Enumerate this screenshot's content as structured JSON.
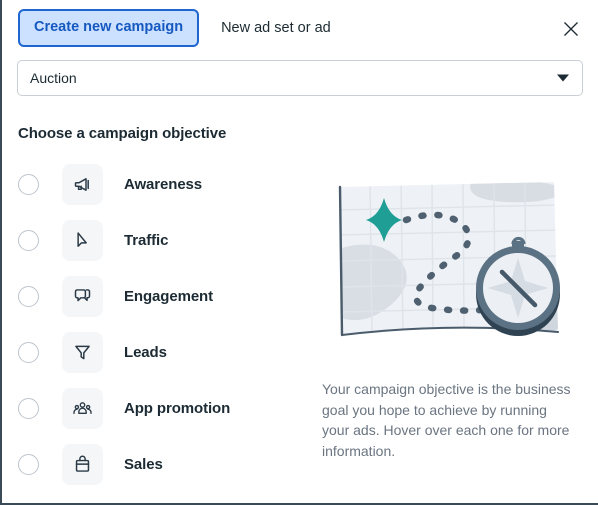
{
  "header": {
    "primary_tab": "Create new campaign",
    "secondary_tab": "New ad set or ad",
    "close_icon": "close-icon"
  },
  "buying_type": {
    "value": "Auction",
    "placeholder": "Auction",
    "caret_icon": "chevron-down-icon"
  },
  "objective_section": {
    "title": "Choose a campaign objective",
    "items": [
      {
        "label": "Awareness",
        "icon": "megaphone-icon",
        "selected": false
      },
      {
        "label": "Traffic",
        "icon": "cursor-icon",
        "selected": false
      },
      {
        "label": "Engagement",
        "icon": "chat-bubbles-icon",
        "selected": false
      },
      {
        "label": "Leads",
        "icon": "funnel-icon",
        "selected": false
      },
      {
        "label": "App promotion",
        "icon": "people-icon",
        "selected": false
      },
      {
        "label": "Sales",
        "icon": "shopping-bag-icon",
        "selected": false
      }
    ]
  },
  "info_panel": {
    "illustration": "map-with-compass-illustration",
    "description": "Your campaign objective is the business goal you hope to achieve by running your ads. Hover over each one for more information."
  },
  "colors": {
    "accent_blue": "#1559c0",
    "tab_bg": "#cce0ff",
    "tab_border": "#1e66d0",
    "text_dark": "#1c2b33",
    "text_muted": "#6a7581",
    "tile_bg": "#f5f6f7",
    "radio_border": "#bcc4cd",
    "map_teal": "#1f9e96",
    "map_paper": "#eef1f5",
    "compass_dark": "#3c4d5c"
  }
}
